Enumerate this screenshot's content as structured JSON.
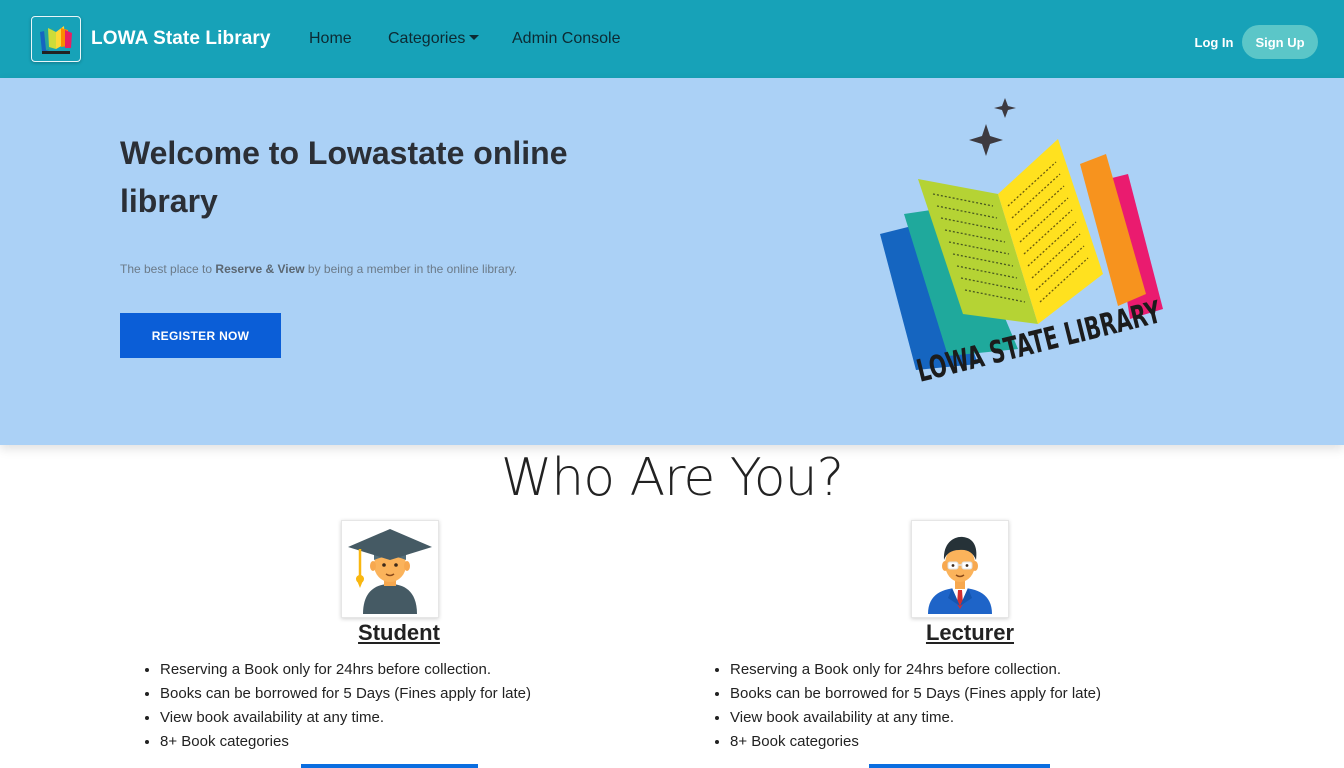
{
  "navbar": {
    "brand_title": "LOWA State Library",
    "logo_icon": "library-book-logo",
    "links": {
      "home": "Home",
      "categories": "Categories",
      "admin": "Admin Console"
    },
    "login_label": "Log In",
    "signup_label": "Sign Up",
    "colors": {
      "background": "#17a2b8",
      "signup": "#5bc6c8"
    }
  },
  "hero": {
    "title": "Welcome to Lowastate online library",
    "tagline_prefix": "The best place to",
    "tagline_bold": "Reserve & View",
    "tagline_suffix": "by being a member in the online library.",
    "register_label": "REGISTER NOW",
    "art_label": "LOWA STATE LIBRARY",
    "colors": {
      "background": "#abd1f6",
      "button": "#0b5ed7"
    }
  },
  "section": {
    "title": "Who Are You?"
  },
  "cards": {
    "student": {
      "title": "Student",
      "icon": "student-graduate-icon",
      "features": [
        "Reserving a Book only for 24hrs before collection.",
        "Books can be borrowed for 5 Days (Fines apply for late)",
        "View book availability at any time.",
        "8+ Book categories"
      ]
    },
    "lecturer": {
      "title": "Lecturer",
      "icon": "lecturer-teacher-icon",
      "features": [
        "Reserving a Book only for 24hrs before collection.",
        "Books can be borrowed for 5 Days (Fines apply for late)",
        "View book availability at any time.",
        "8+ Book categories"
      ]
    }
  }
}
